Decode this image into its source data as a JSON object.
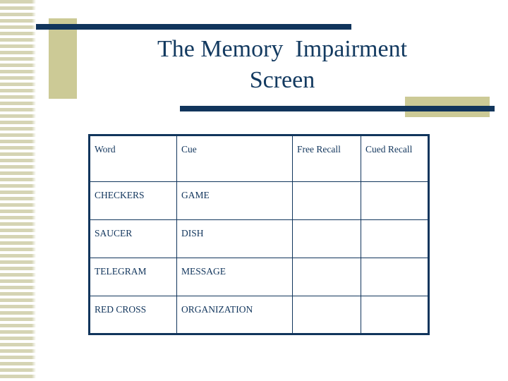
{
  "slide": {
    "title_line1": "The Memory  Impairment",
    "title_line2": "Screen",
    "colors": {
      "navy": "#11355c",
      "beige": "#ccca96",
      "stripe": "#d5d4b4",
      "background": "#ffffff"
    }
  },
  "table": {
    "headers": {
      "word": "Word",
      "cue": "Cue",
      "free_recall": "Free Recall",
      "cued_recall": "Cued Recall"
    },
    "rows": [
      {
        "word": "CHECKERS",
        "cue": "GAME",
        "free_recall": "",
        "cued_recall": ""
      },
      {
        "word": "SAUCER",
        "cue": "DISH",
        "free_recall": "",
        "cued_recall": ""
      },
      {
        "word": "TELEGRAM",
        "cue": "MESSAGE",
        "free_recall": "",
        "cued_recall": ""
      },
      {
        "word": "RED CROSS",
        "cue": "ORGANIZATION",
        "free_recall": "",
        "cued_recall": ""
      }
    ]
  }
}
